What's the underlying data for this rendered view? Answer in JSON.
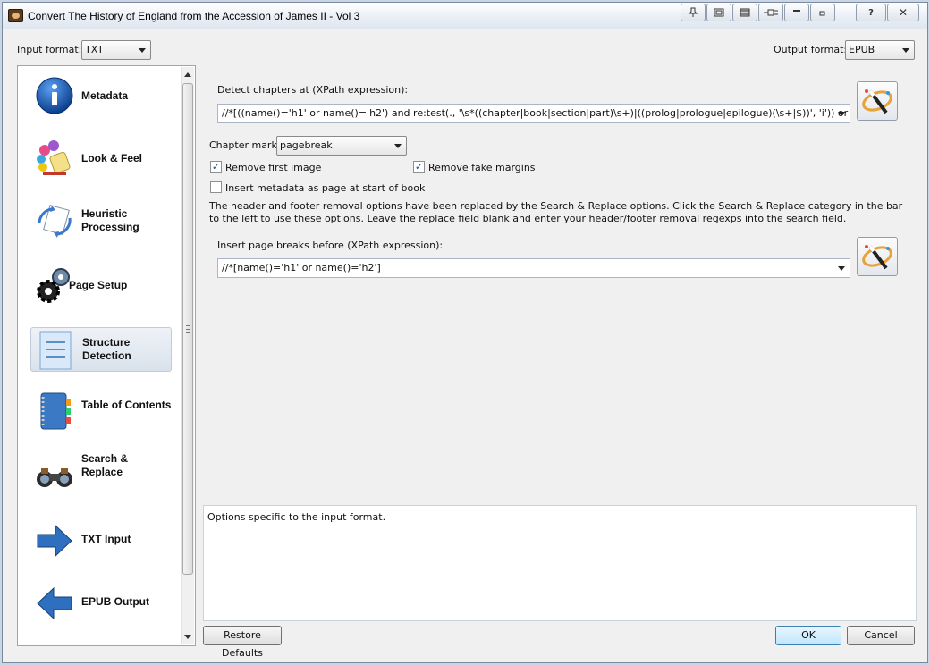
{
  "window": {
    "title": "Convert The History of England from the Accession of James II - Vol 3",
    "titlebar_buttons": [
      "pin-icon",
      "window-icon",
      "film-icon",
      "plug-icon",
      "minimize-icon",
      "restore-icon",
      "help-icon",
      "close-icon"
    ],
    "help_label": "?",
    "close_label": "✕"
  },
  "input_format": {
    "label": "Input format:",
    "value": "TXT"
  },
  "output_format": {
    "label": "Output format:",
    "value": "EPUB"
  },
  "sidebar": {
    "items": [
      {
        "label": "Metadata",
        "icon": "info-icon"
      },
      {
        "label": "Look & Feel",
        "icon": "paint-icon"
      },
      {
        "label": "Heuristic Processing",
        "icon": "heuristic-icon"
      },
      {
        "label": "Page Setup",
        "icon": "gears-icon"
      },
      {
        "label": "Structure Detection",
        "icon": "document-icon",
        "selected": true
      },
      {
        "label": "Table of Contents",
        "icon": "notebook-icon"
      },
      {
        "label": "Search & Replace",
        "icon": "binoculars-icon"
      },
      {
        "label": "TXT Input",
        "icon": "arrow-right-icon"
      },
      {
        "label": "EPUB Output",
        "icon": "arrow-left-icon"
      }
    ]
  },
  "structure": {
    "detect_chapters_label": "Detect chapters at (XPath expression):",
    "detect_chapters_value": "//*[((name()='h1' or name()='h2') and re:test(., '\\s*((chapter|book|section|part)\\s+)|((prolog|prologue|epilogue)(\\s+|$))', 'i')) or @class = 'cha",
    "chapter_mark_label": "Chapter mark:",
    "chapter_mark_value": "pagebreak",
    "remove_first_image_label": "Remove first image",
    "remove_first_image_checked": true,
    "remove_fake_margins_label": "Remove fake margins",
    "remove_fake_margins_checked": true,
    "insert_metadata_label": "Insert metadata as page at start of book",
    "insert_metadata_checked": false,
    "header_footer_note": "The header and footer removal options have been replaced by the Search & Replace options. Click the Search & Replace category in the bar to the left to use these options. Leave the replace field blank and enter your header/footer removal regexps into the search field.",
    "page_breaks_label": "Insert page breaks before (XPath expression):",
    "page_breaks_value": "//*[name()='h1' or name()='h2']"
  },
  "description": "Options specific to the input format.",
  "buttons": {
    "restore_defaults": "Restore Defaults",
    "ok": "OK",
    "cancel": "Cancel"
  },
  "colors": {
    "accent_blue": "#1f5fa8",
    "selected_bg": "#dbe4ee"
  }
}
